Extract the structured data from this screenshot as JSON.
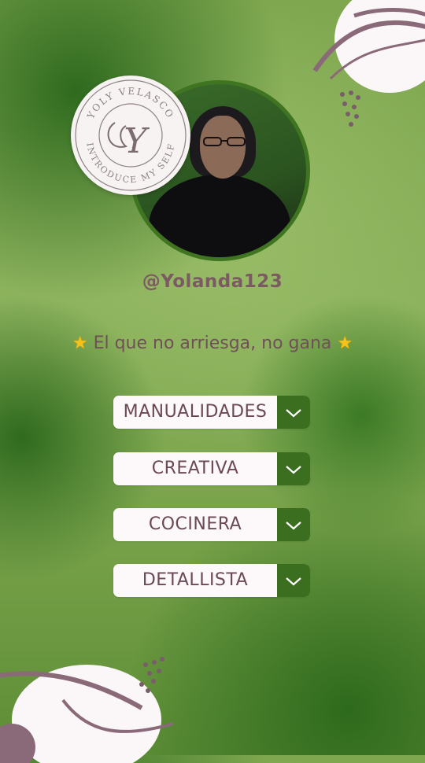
{
  "profile": {
    "username": "@Yolanda123",
    "stamp_top_text": "YOLY VELASCO",
    "stamp_bottom_text": "INTRODUCE MY SELF",
    "stamp_monogram": "Y"
  },
  "motto": {
    "text": "El que no arriesga, no gana",
    "left_icon": "star-emoji",
    "right_icon": "star-emoji"
  },
  "dropdowns": [
    {
      "label": "MANUALIDADES"
    },
    {
      "label": "CREATIVA"
    },
    {
      "label": "COCINERA"
    },
    {
      "label": "DETALLISTA"
    }
  ],
  "colors": {
    "background": "#86ad56",
    "accent_dark_green": "#3c6e1f",
    "text_mauve": "#7b5a63",
    "button_bg": "#fdf8f9"
  }
}
